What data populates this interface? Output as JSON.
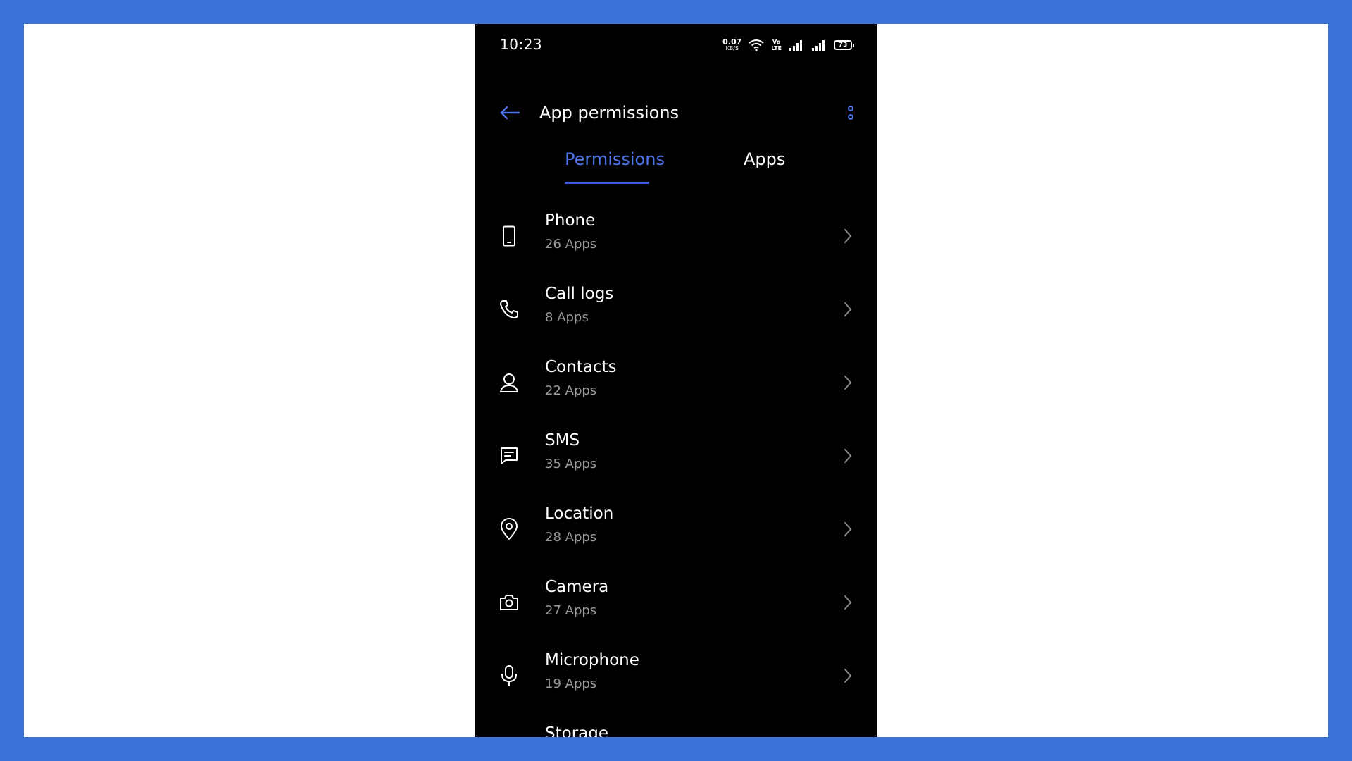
{
  "status_bar": {
    "time": "10:23",
    "net_speed_value": "0.07",
    "net_speed_unit": "KB/S",
    "volte_top": "Vo",
    "volte_bottom": "LTE",
    "battery": "73"
  },
  "header": {
    "title": "App permissions",
    "back_icon": "arrow-left-icon",
    "more_icon": "more-vertical-icon"
  },
  "tabs": [
    {
      "label": "Permissions",
      "active": true
    },
    {
      "label": "Apps",
      "active": false
    }
  ],
  "colors": {
    "accent": "#4f73e8",
    "background": "#000000",
    "frame": "#3a72d8",
    "subtext": "#9a9a9a"
  },
  "permissions": [
    {
      "title": "Phone",
      "subtitle": "26 Apps",
      "icon": "phone-device-icon"
    },
    {
      "title": "Call logs",
      "subtitle": "8 Apps",
      "icon": "phone-call-icon"
    },
    {
      "title": "Contacts",
      "subtitle": "22 Apps",
      "icon": "person-icon"
    },
    {
      "title": "SMS",
      "subtitle": "35 Apps",
      "icon": "message-icon"
    },
    {
      "title": "Location",
      "subtitle": "28 Apps",
      "icon": "location-pin-icon"
    },
    {
      "title": "Camera",
      "subtitle": "27 Apps",
      "icon": "camera-icon"
    },
    {
      "title": "Microphone",
      "subtitle": "19 Apps",
      "icon": "microphone-icon"
    },
    {
      "title": "Storage",
      "subtitle": "",
      "icon": "storage-icon"
    }
  ]
}
